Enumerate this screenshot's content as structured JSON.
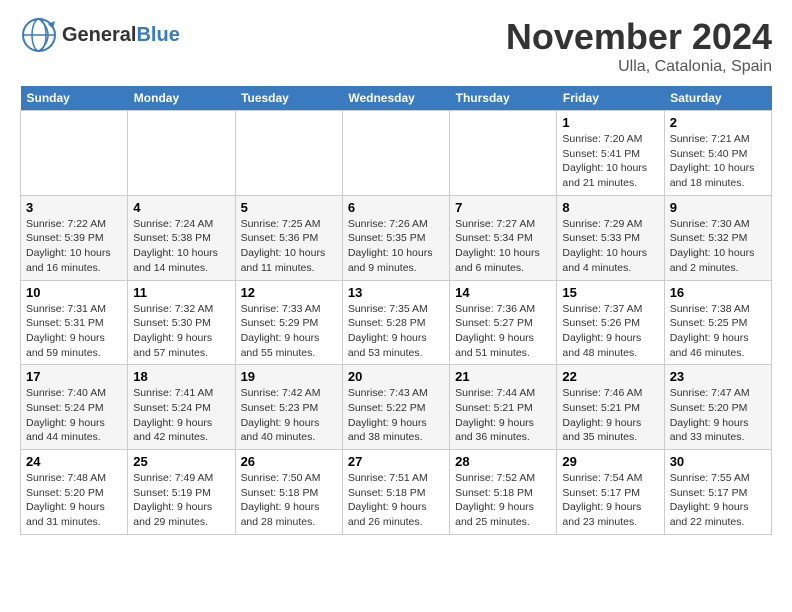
{
  "header": {
    "logo_general": "General",
    "logo_blue": "Blue",
    "month_title": "November 2024",
    "location": "Ulla, Catalonia, Spain"
  },
  "weekdays": [
    "Sunday",
    "Monday",
    "Tuesday",
    "Wednesday",
    "Thursday",
    "Friday",
    "Saturday"
  ],
  "days": [
    {
      "date": "",
      "info": ""
    },
    {
      "date": "",
      "info": ""
    },
    {
      "date": "",
      "info": ""
    },
    {
      "date": "",
      "info": ""
    },
    {
      "date": "",
      "info": ""
    },
    {
      "date": "1",
      "info": "Sunrise: 7:20 AM\nSunset: 5:41 PM\nDaylight: 10 hours\nand 21 minutes."
    },
    {
      "date": "2",
      "info": "Sunrise: 7:21 AM\nSunset: 5:40 PM\nDaylight: 10 hours\nand 18 minutes."
    },
    {
      "date": "3",
      "info": "Sunrise: 7:22 AM\nSunset: 5:39 PM\nDaylight: 10 hours\nand 16 minutes."
    },
    {
      "date": "4",
      "info": "Sunrise: 7:24 AM\nSunset: 5:38 PM\nDaylight: 10 hours\nand 14 minutes."
    },
    {
      "date": "5",
      "info": "Sunrise: 7:25 AM\nSunset: 5:36 PM\nDaylight: 10 hours\nand 11 minutes."
    },
    {
      "date": "6",
      "info": "Sunrise: 7:26 AM\nSunset: 5:35 PM\nDaylight: 10 hours\nand 9 minutes."
    },
    {
      "date": "7",
      "info": "Sunrise: 7:27 AM\nSunset: 5:34 PM\nDaylight: 10 hours\nand 6 minutes."
    },
    {
      "date": "8",
      "info": "Sunrise: 7:29 AM\nSunset: 5:33 PM\nDaylight: 10 hours\nand 4 minutes."
    },
    {
      "date": "9",
      "info": "Sunrise: 7:30 AM\nSunset: 5:32 PM\nDaylight: 10 hours\nand 2 minutes."
    },
    {
      "date": "10",
      "info": "Sunrise: 7:31 AM\nSunset: 5:31 PM\nDaylight: 9 hours\nand 59 minutes."
    },
    {
      "date": "11",
      "info": "Sunrise: 7:32 AM\nSunset: 5:30 PM\nDaylight: 9 hours\nand 57 minutes."
    },
    {
      "date": "12",
      "info": "Sunrise: 7:33 AM\nSunset: 5:29 PM\nDaylight: 9 hours\nand 55 minutes."
    },
    {
      "date": "13",
      "info": "Sunrise: 7:35 AM\nSunset: 5:28 PM\nDaylight: 9 hours\nand 53 minutes."
    },
    {
      "date": "14",
      "info": "Sunrise: 7:36 AM\nSunset: 5:27 PM\nDaylight: 9 hours\nand 51 minutes."
    },
    {
      "date": "15",
      "info": "Sunrise: 7:37 AM\nSunset: 5:26 PM\nDaylight: 9 hours\nand 48 minutes."
    },
    {
      "date": "16",
      "info": "Sunrise: 7:38 AM\nSunset: 5:25 PM\nDaylight: 9 hours\nand 46 minutes."
    },
    {
      "date": "17",
      "info": "Sunrise: 7:40 AM\nSunset: 5:24 PM\nDaylight: 9 hours\nand 44 minutes."
    },
    {
      "date": "18",
      "info": "Sunrise: 7:41 AM\nSunset: 5:24 PM\nDaylight: 9 hours\nand 42 minutes."
    },
    {
      "date": "19",
      "info": "Sunrise: 7:42 AM\nSunset: 5:23 PM\nDaylight: 9 hours\nand 40 minutes."
    },
    {
      "date": "20",
      "info": "Sunrise: 7:43 AM\nSunset: 5:22 PM\nDaylight: 9 hours\nand 38 minutes."
    },
    {
      "date": "21",
      "info": "Sunrise: 7:44 AM\nSunset: 5:21 PM\nDaylight: 9 hours\nand 36 minutes."
    },
    {
      "date": "22",
      "info": "Sunrise: 7:46 AM\nSunset: 5:21 PM\nDaylight: 9 hours\nand 35 minutes."
    },
    {
      "date": "23",
      "info": "Sunrise: 7:47 AM\nSunset: 5:20 PM\nDaylight: 9 hours\nand 33 minutes."
    },
    {
      "date": "24",
      "info": "Sunrise: 7:48 AM\nSunset: 5:20 PM\nDaylight: 9 hours\nand 31 minutes."
    },
    {
      "date": "25",
      "info": "Sunrise: 7:49 AM\nSunset: 5:19 PM\nDaylight: 9 hours\nand 29 minutes."
    },
    {
      "date": "26",
      "info": "Sunrise: 7:50 AM\nSunset: 5:18 PM\nDaylight: 9 hours\nand 28 minutes."
    },
    {
      "date": "27",
      "info": "Sunrise: 7:51 AM\nSunset: 5:18 PM\nDaylight: 9 hours\nand 26 minutes."
    },
    {
      "date": "28",
      "info": "Sunrise: 7:52 AM\nSunset: 5:18 PM\nDaylight: 9 hours\nand 25 minutes."
    },
    {
      "date": "29",
      "info": "Sunrise: 7:54 AM\nSunset: 5:17 PM\nDaylight: 9 hours\nand 23 minutes."
    },
    {
      "date": "30",
      "info": "Sunrise: 7:55 AM\nSunset: 5:17 PM\nDaylight: 9 hours\nand 22 minutes."
    }
  ]
}
